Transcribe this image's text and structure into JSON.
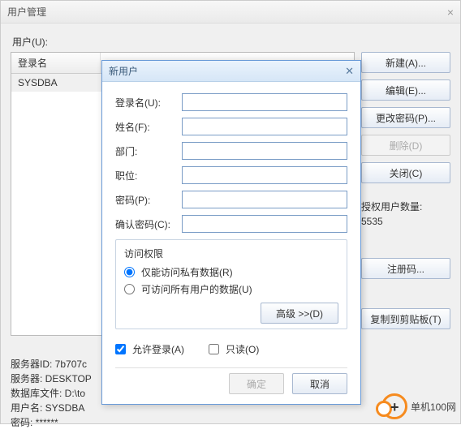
{
  "mainWindow": {
    "title": "用户管理",
    "userLabel": "用户(U):",
    "table": {
      "columns": [
        "登录名"
      ],
      "rows": [
        {
          "login": "SYSDBA"
        }
      ]
    },
    "buttons": {
      "new": "新建(A)...",
      "edit": "编辑(E)...",
      "changePwd": "更改密码(P)...",
      "delete": "删除(D)",
      "close": "关闭(C)",
      "register": "注册码...",
      "copy": "复制到剪贴板(T)"
    },
    "authCountLabel": "授权用户数量:",
    "authCountValue": "5535",
    "info": {
      "serverId": "服务器ID: 7b707c",
      "server": "服务器: DESKTOP",
      "dbFile": "数据库文件: D:\\to",
      "username": "用户名: SYSDBA",
      "password": "密码: ******"
    }
  },
  "modal": {
    "title": "新用户",
    "labels": {
      "login": "登录名(U):",
      "name": "姓名(F):",
      "dept": "部门:",
      "position": "职位:",
      "password": "密码(P):",
      "confirm": "确认密码(C):"
    },
    "fieldset": {
      "legend": "访问权限",
      "private": "仅能访问私有数据(R)",
      "all": "可访问所有用户的数据(U)"
    },
    "advanced": "高级 >>(D)",
    "allowLogin": "允许登录(A)",
    "readonly": "只读(O)",
    "ok": "确定",
    "cancel": "取消"
  },
  "watermark": "单机100网"
}
